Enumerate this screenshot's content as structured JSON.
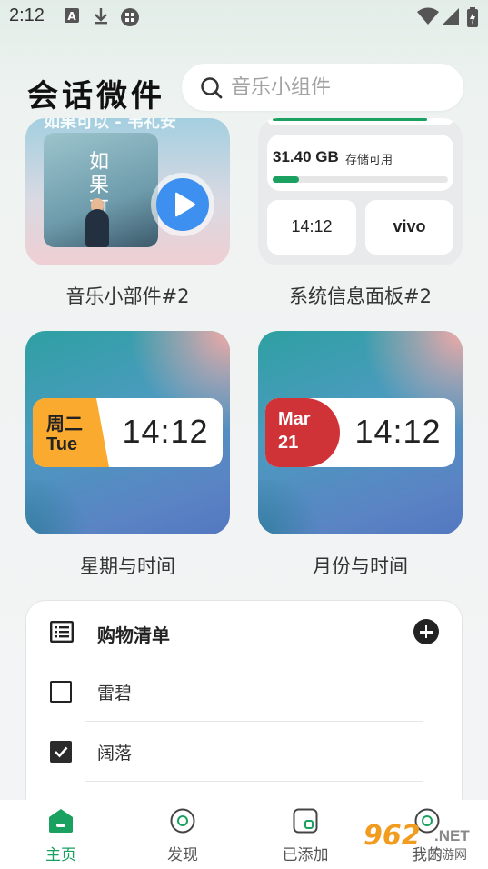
{
  "status_bar": {
    "time": "2:12",
    "left_icons": [
      "a-letter-icon",
      "download-icon",
      "app-grid-icon"
    ],
    "right_icons": [
      "wifi-icon",
      "cellular-icon",
      "battery-charging-icon"
    ]
  },
  "header": {
    "title": "会话微件",
    "search": {
      "placeholder": "音乐小组件",
      "value": ""
    }
  },
  "widgets": {
    "music": {
      "label": "音乐小部件#2",
      "top_text": "如果可以 - 韦礼安",
      "cover_text": "如果可以",
      "colors": {
        "accent": "#3d8ff0"
      }
    },
    "system_info": {
      "label": "系统信息面板#2",
      "storage_value": "31.40 GB",
      "storage_label": "存储可用",
      "storage_fill_fraction": 0.15,
      "time": "14:12",
      "brand": "vivo",
      "colors": {
        "accent": "#1aa160"
      }
    },
    "week_time": {
      "label": "星期与时间",
      "day_cn": "周二",
      "day_en": "Tue",
      "time": "14:12",
      "colors": {
        "badge": "#f9aa2f"
      }
    },
    "month_time": {
      "label": "月份与时间",
      "month": "Mar",
      "day": "21",
      "time": "14:12",
      "colors": {
        "badge": "#cf3337"
      }
    }
  },
  "shopping_list": {
    "title": "购物清单",
    "items": [
      {
        "text": "雷碧",
        "checked": false
      },
      {
        "text": "阔落",
        "checked": true
      }
    ]
  },
  "bottom_nav": {
    "items": [
      {
        "label": "主页",
        "icon": "home-icon",
        "active": true
      },
      {
        "label": "发现",
        "icon": "discover-icon",
        "active": false
      },
      {
        "label": "已添加",
        "icon": "added-icon",
        "active": false
      },
      {
        "label": "我的",
        "icon": "profile-icon",
        "active": false
      }
    ]
  },
  "watermark": {
    "number": "962",
    "suffix": ".NET",
    "site": "乐游网"
  }
}
